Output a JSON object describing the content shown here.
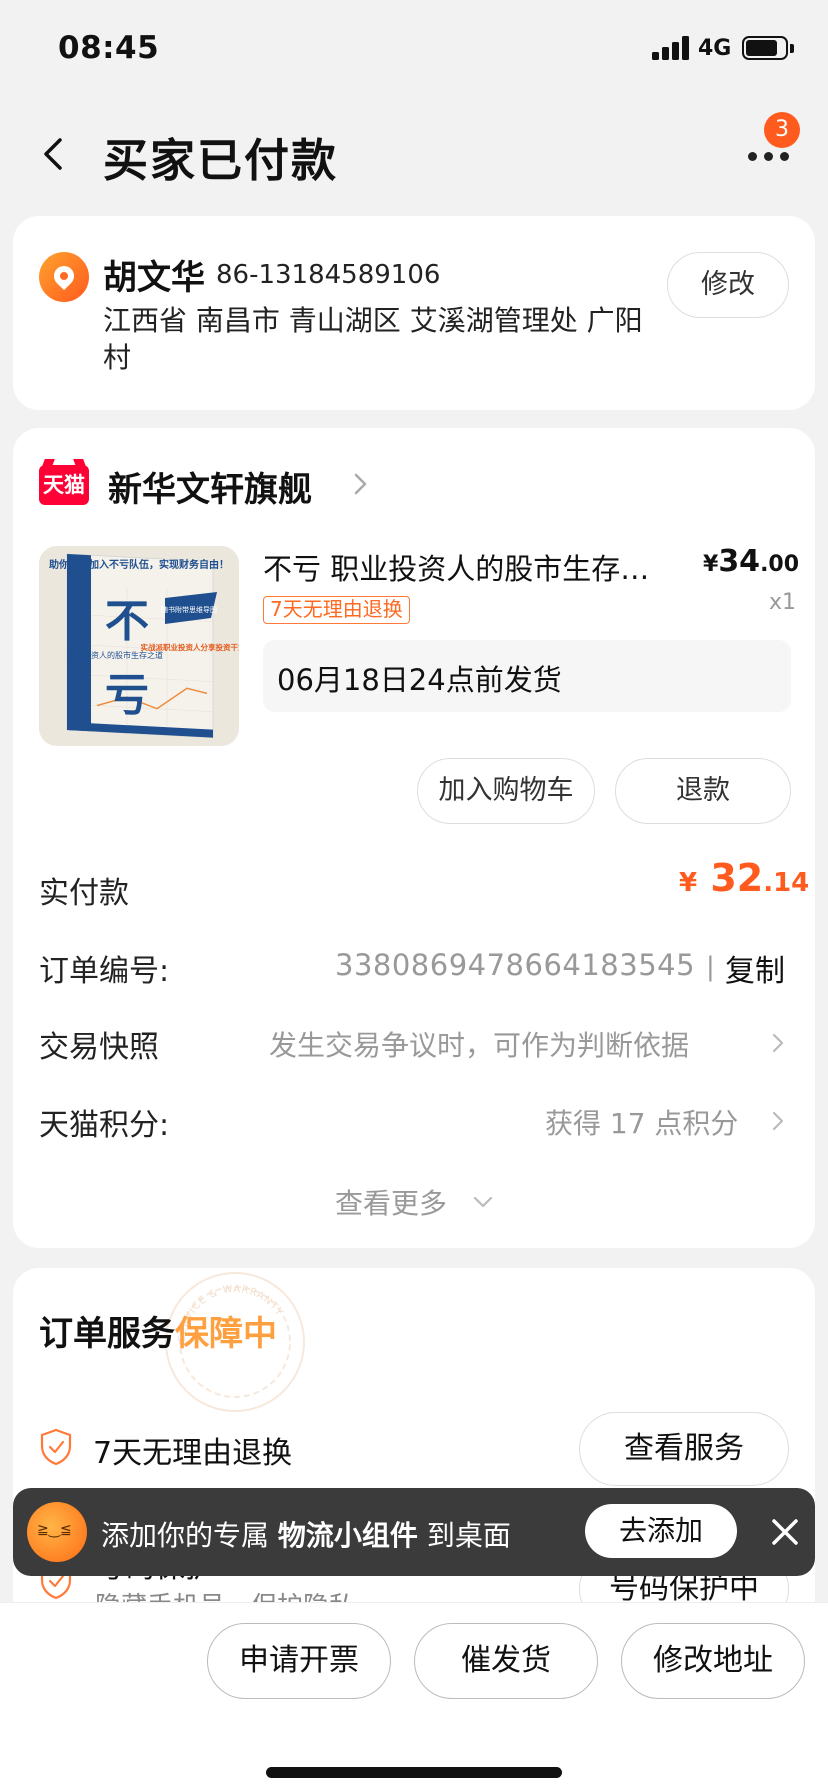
{
  "status_bar": {
    "time": "08:45",
    "network": "4G",
    "battery_level": 0.85
  },
  "header": {
    "title": "买家已付款",
    "notification_count": "3"
  },
  "address": {
    "name": "胡文华",
    "phone": "86-13184589106",
    "detail": "江西省 南昌市 青山湖区 艾溪湖管理处 广阳村",
    "modify_label": "修改"
  },
  "store": {
    "logo_text": "天猫",
    "name": "新华文轩旗舰"
  },
  "product": {
    "title": "不亏 职业投资人的股市生存之道",
    "price_int": "34",
    "price_dec": ".00",
    "currency": "¥",
    "quantity": "x1",
    "return_tag": "7天无理由退换",
    "ship_notice": "06月18日24点前发货",
    "cover_text": {
      "banner": "助你早日加入不亏队伍，实现财务自由！",
      "big1": "不",
      "big2": "亏",
      "subtitle": "职业投资人的股市生存之道",
      "badge": "随书附带思维导图",
      "side": "实战派职业投资人分享投资干货"
    },
    "add_cart_label": "加入购物车",
    "refund_label": "退款"
  },
  "payment": {
    "label": "实付款",
    "currency": "¥",
    "amount_int": "32",
    "amount_dec": ".14"
  },
  "order_info": {
    "order_no_label": "订单编号:",
    "order_no": "3380869478664183545",
    "separator": "|",
    "copy_label": "复制",
    "snapshot_label": "交易快照",
    "snapshot_value": "发生交易争议时，可作为判断依据",
    "points_label": "天猫积分:",
    "points_value": "获得 17 点积分",
    "see_more": "查看更多"
  },
  "service": {
    "title_prefix": "订单服务",
    "title_highlight": "保障中",
    "stamp_text": "SERVICE & WARRANTY",
    "items": [
      {
        "label": "7天无理由退换",
        "button": "查看服务"
      },
      {
        "label": "号码保护",
        "sub": "隐藏手机号，保护隐私",
        "button": "号码保护中"
      }
    ]
  },
  "toast": {
    "text_before": "添加你的专属 ",
    "text_bold": "物流小组件",
    "text_after": " 到桌面",
    "add_label": "去添加"
  },
  "bottom_bar": {
    "invoice_label": "申请开票",
    "remind_label": "催发货",
    "change_address_label": "修改地址"
  },
  "colors": {
    "accent": "#ff5b1f",
    "highlight": "#ffa040",
    "tmall": "#ff0036"
  }
}
